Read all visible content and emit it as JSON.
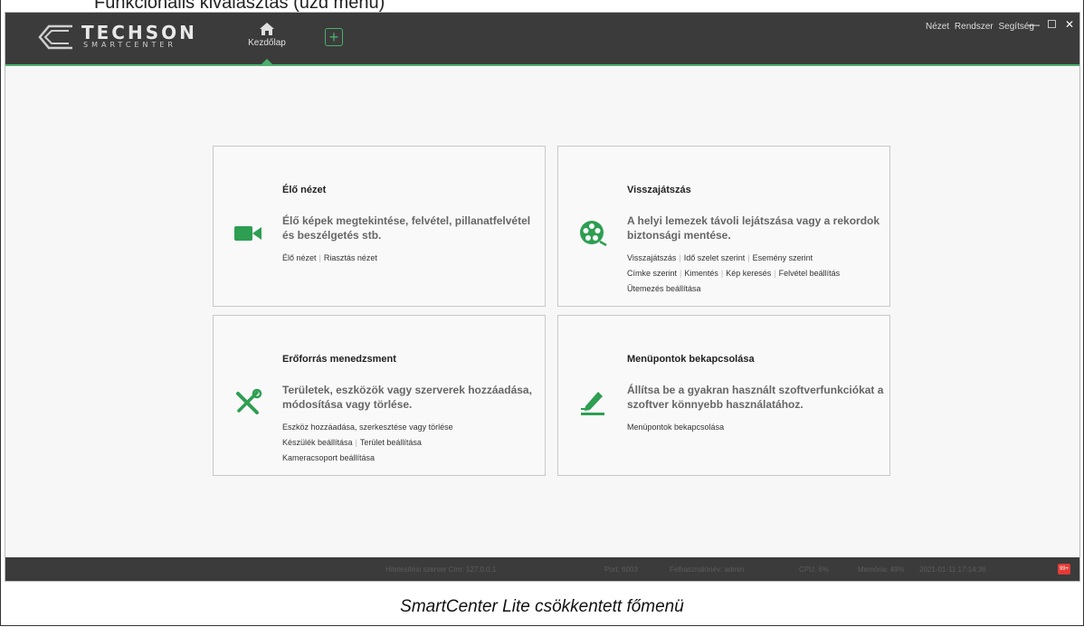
{
  "document": {
    "heading": "Funkcionális kiválasztás (üzd menü)",
    "caption": "SmartCenter Lite csökkentett főmenü"
  },
  "app": {
    "brand": "TECHSON",
    "brand_sub": "SMARTCENTER",
    "home_tab_label": "Kezdőlap",
    "add_tab_symbol": "+",
    "menus": [
      "Nézet",
      "Rendszer",
      "Segítség"
    ],
    "window_buttons": {
      "minimize": "—",
      "maximize": "☐",
      "close": "✕"
    },
    "accent_color": "#4caf6e"
  },
  "cards": {
    "live": {
      "title": "Élő nézet",
      "desc": "Élő képek megtekintése, felvétel, pillanatfelvétel és beszélgetés stb.",
      "icon": "video-camera-icon",
      "links": [
        "Élő nézet",
        "Riasztás nézet"
      ]
    },
    "playback": {
      "title": "Visszajátszás",
      "desc": "A helyi lemezek távoli lejátszása vagy a rekordok biztonsági mentése.",
      "icon": "film-reel-icon",
      "links_line1": [
        "Visszajátszás",
        "Idő szelet szerint",
        "Esemény szerint"
      ],
      "links_line2": [
        "Címke szerint",
        "Kimentés",
        "Kép keresés",
        "Felvétel beállítás"
      ],
      "links_line3": [
        "Ütemezés beállítása"
      ]
    },
    "resource": {
      "title": "Erőforrás menedzsment",
      "desc": "Területek, eszközök vagy szerverek hozzáadása, módosítása vagy törlése.",
      "icon": "tools-icon",
      "links_line1": [
        "Eszköz hozzáadása, szerkesztése vagy törlése"
      ],
      "links_line2": [
        "Készülék beállítása",
        "Terület beállítása"
      ],
      "links_line3": [
        "Kameracsoport beállítása"
      ]
    },
    "menu_items": {
      "title": "Menüpontok bekapcsolása",
      "desc": "Állítsa be a gyakran használt szoftverfunkciókat a szoftver könnyebb használatához.",
      "icon": "edit-pen-icon",
      "links": [
        "Menüpontok bekapcsolása"
      ]
    }
  },
  "status": {
    "auth_server": "Hitelesítési szerver Cím: 127.0.0.1",
    "port": "Port: 6003",
    "user": "Felhasználónév: admin",
    "cpu": "CPU: 6%",
    "memory": "Memória: 49%",
    "datetime": "2021-01-11 17:14:36",
    "notifications": "99+"
  }
}
